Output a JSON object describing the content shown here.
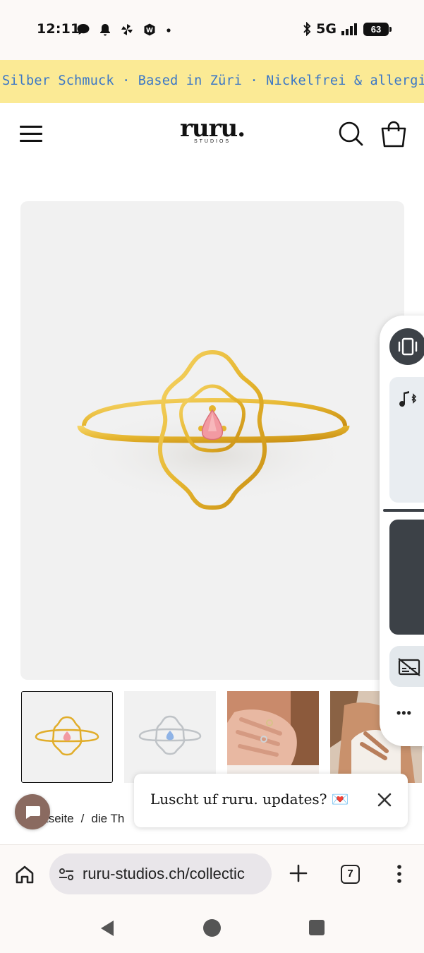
{
  "status_bar": {
    "time": "12:11",
    "left_icons": [
      "chat-bubble-icon",
      "bell-icon",
      "pinwheel-icon",
      "shield-app-icon",
      "dot-icon"
    ],
    "network": "5G",
    "battery": "63"
  },
  "banner": {
    "text": "Silber Schmuck · Based in Züri · Nickelfrei & allergiefreundlich",
    "color": "#3a77c7",
    "background": "#fbea95"
  },
  "header": {
    "logo_main": "ruru.",
    "logo_sub": "STUDIOS",
    "icons": [
      "menu-icon",
      "search-icon",
      "shopping-bag-icon"
    ]
  },
  "product": {
    "image": "gold-ring-pink-stone",
    "thumbnails": [
      "gold-ring-pink-stone",
      "silver-ring-blue-stone",
      "hand-wearing-rings",
      "model-wearing-ring"
    ],
    "selected_thumbnail": 0
  },
  "breadcrumb": {
    "items": [
      "tseite",
      "die Th"
    ],
    "separator": "/"
  },
  "popup": {
    "text": "Luscht uf ruru. updates? 💌"
  },
  "browser": {
    "url": "ruru-studios.ch/collectic",
    "tab_count": "7"
  }
}
